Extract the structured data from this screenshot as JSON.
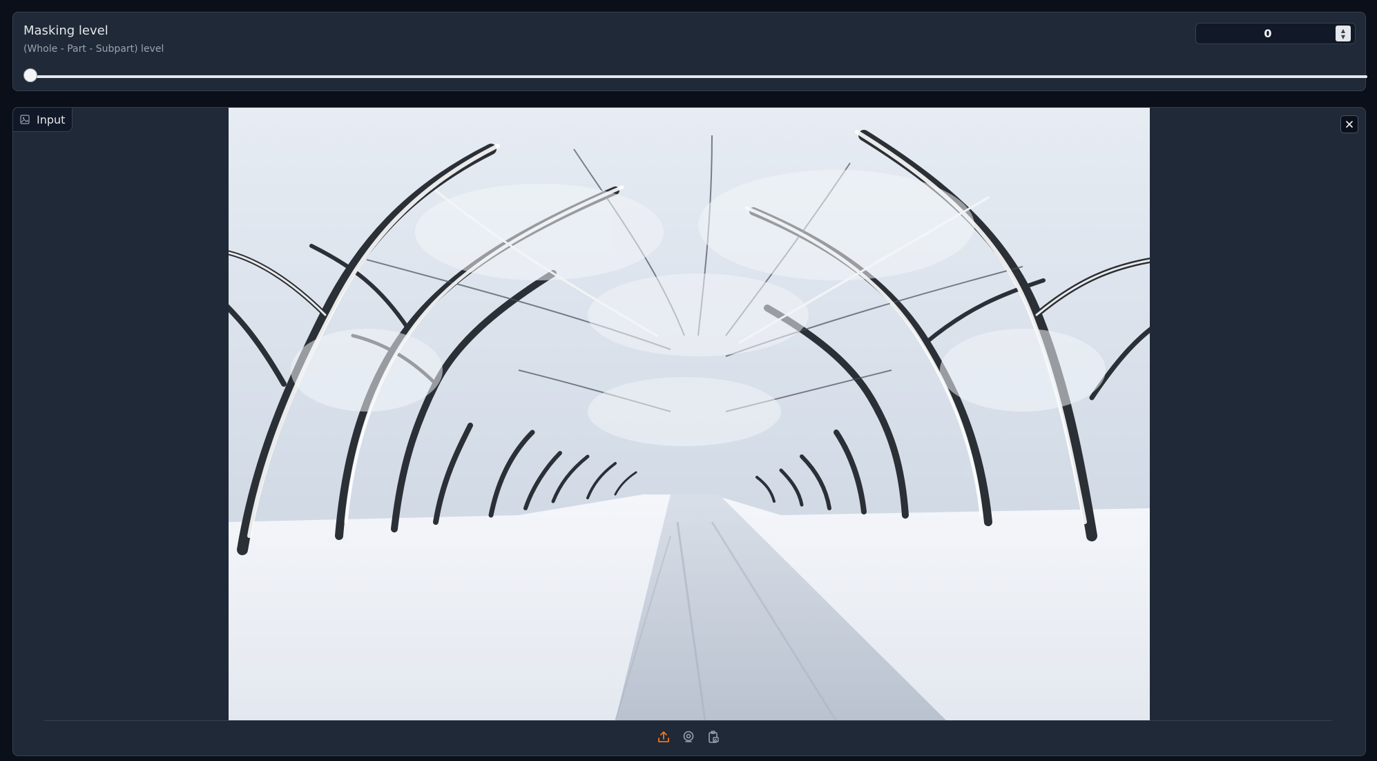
{
  "slider": {
    "label": "Masking level",
    "info": "(Whole - Part - Subpart) level",
    "value": "0",
    "position": 0
  },
  "image_input": {
    "label": "Input",
    "label_icon": "image-icon",
    "close_icon": "close-icon",
    "image_description_alt": "Snow-covered tree-lined road",
    "toolbar": {
      "upload_icon": "upload-icon",
      "webcam_icon": "webcam-icon",
      "clipboard_icon": "clipboard-icon"
    }
  },
  "colors": {
    "page_bg": "#0b0f19",
    "panel_bg": "#1f2937",
    "border": "#374151",
    "accent_orange": "#f97316"
  }
}
